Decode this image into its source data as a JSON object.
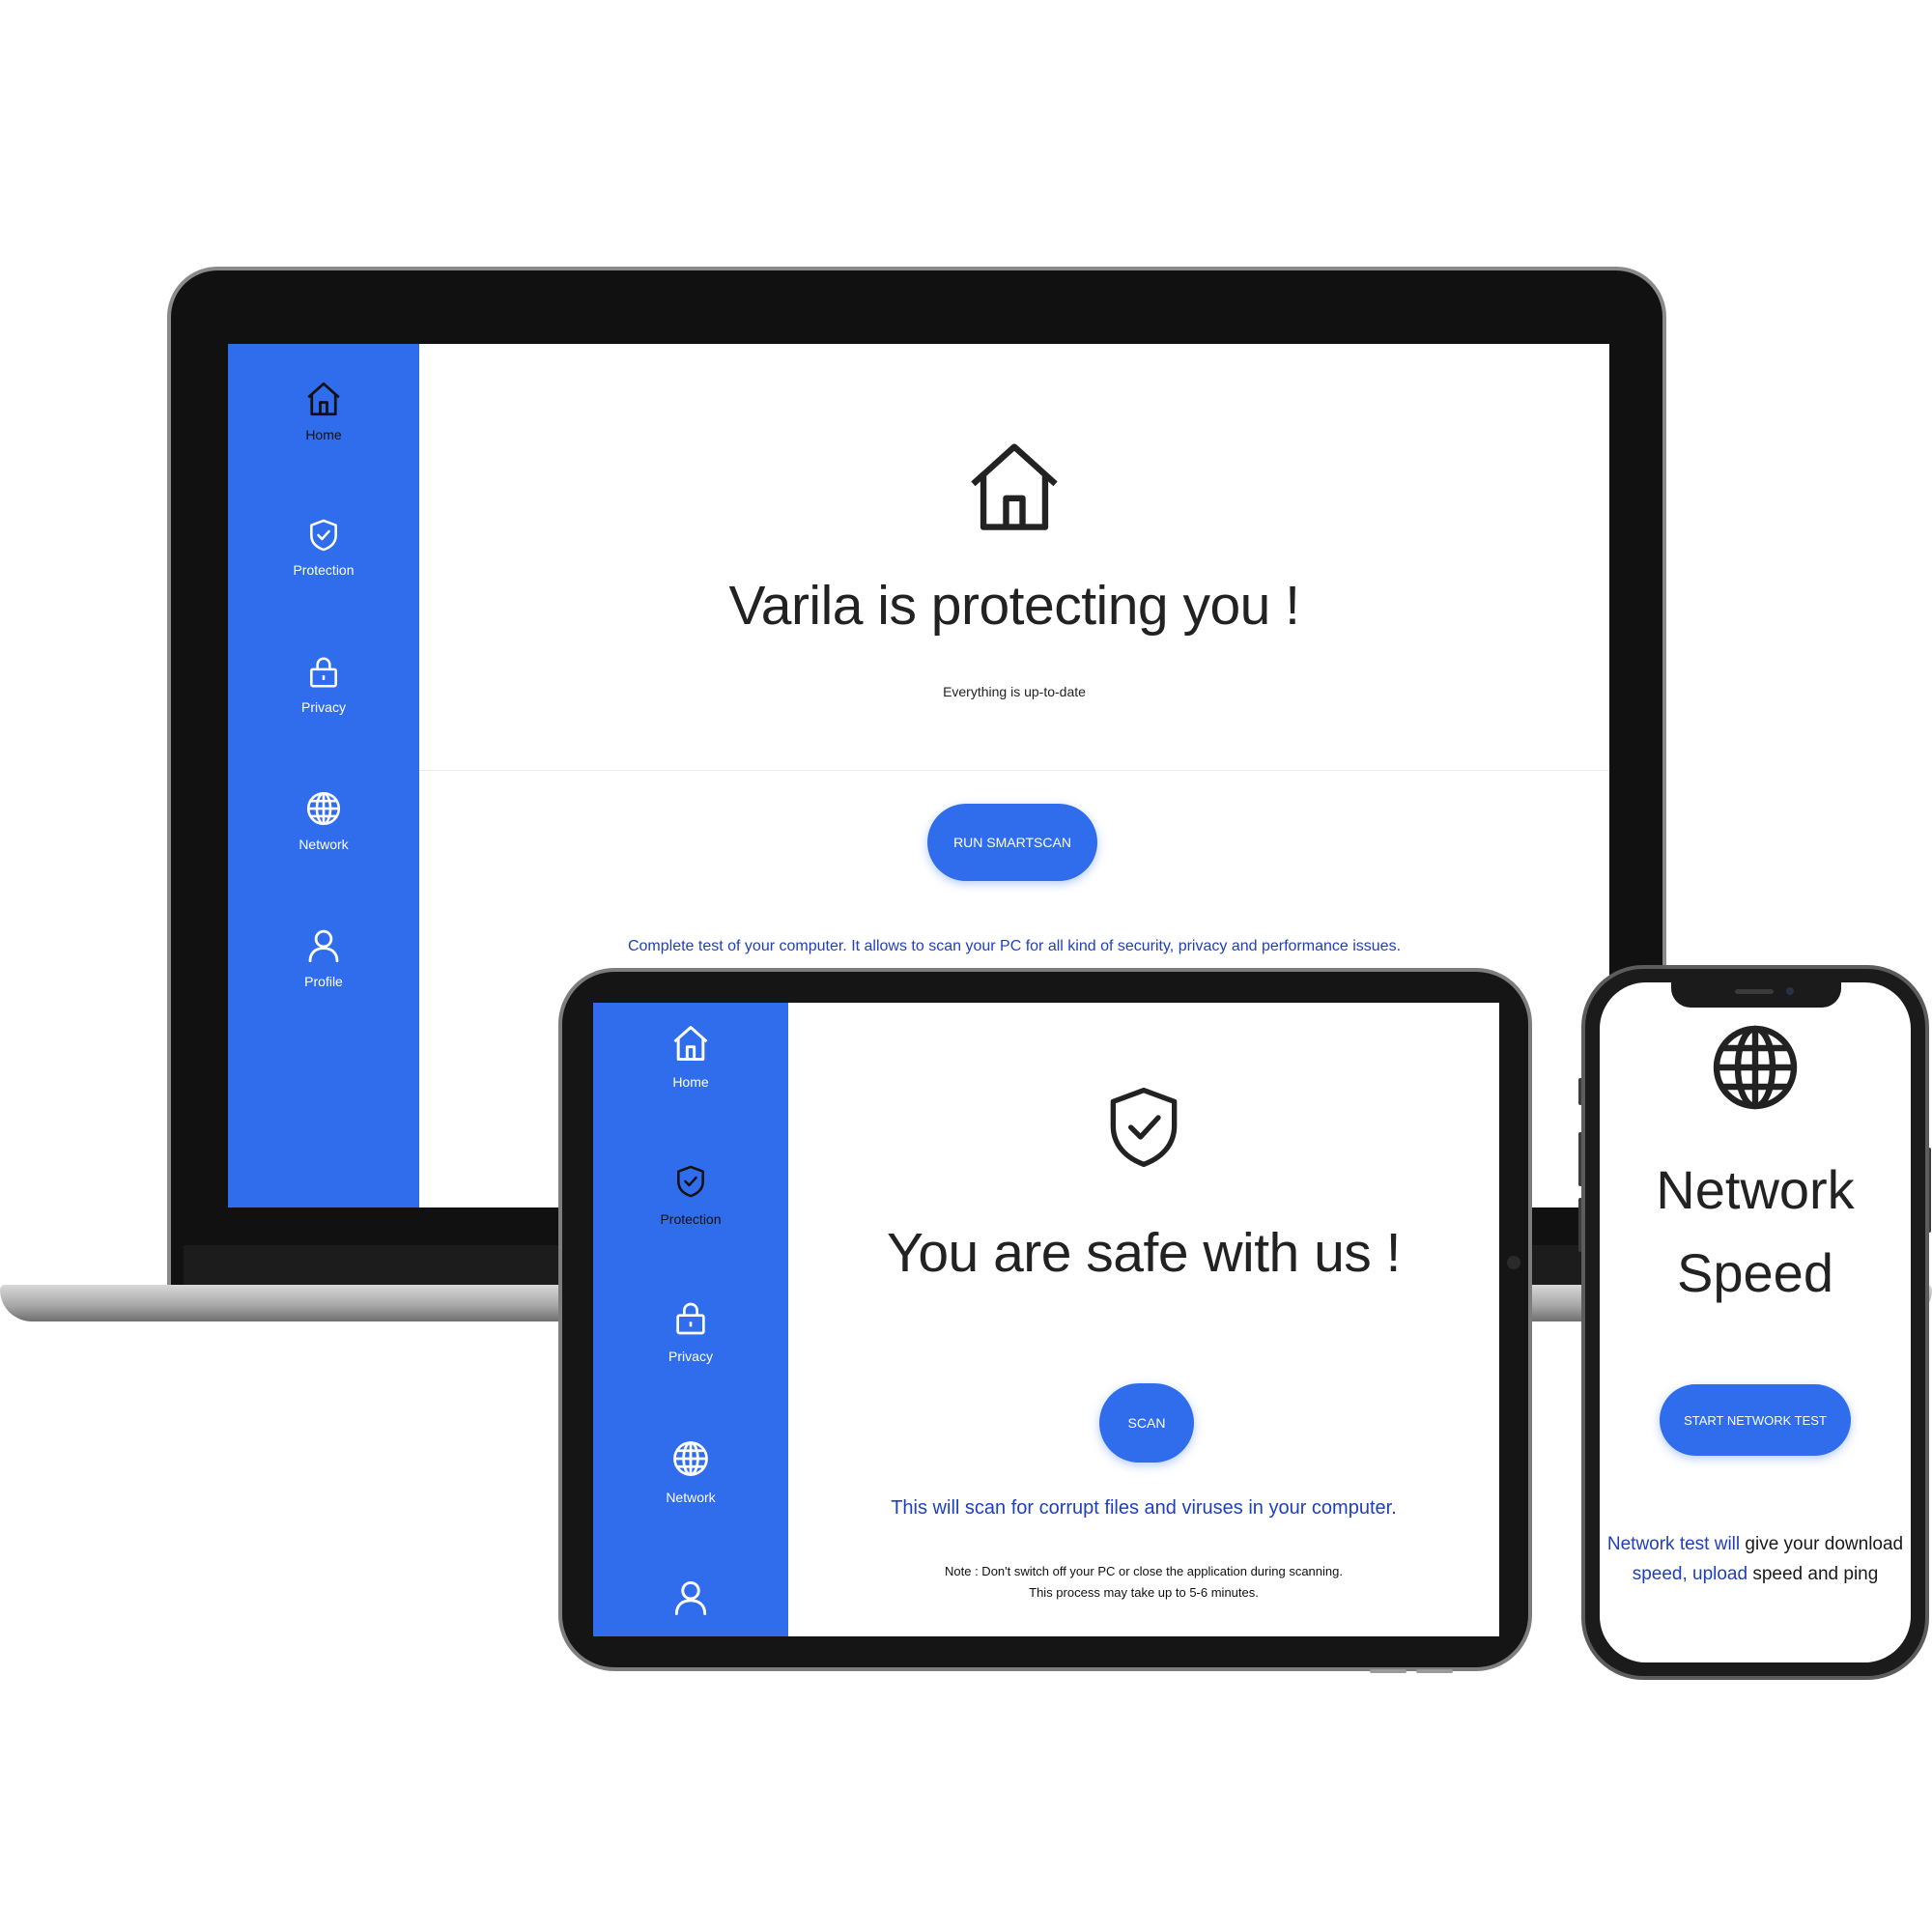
{
  "sidebar_items": [
    {
      "key": "home",
      "label": "Home",
      "icon": "home-icon"
    },
    {
      "key": "protection",
      "label": "Protection",
      "icon": "shield-check-icon"
    },
    {
      "key": "privacy",
      "label": "Privacy",
      "icon": "lock-icon"
    },
    {
      "key": "network",
      "label": "Network",
      "icon": "globe-icon"
    },
    {
      "key": "profile",
      "label": "Profile",
      "icon": "user-icon"
    }
  ],
  "laptop": {
    "headline": "Varila is protecting you !",
    "subtitle": "Everything is up-to-date",
    "button_label": "RUN SMARTSCAN",
    "description": "Complete test of your computer. It allows to scan your PC for all kind of security, privacy and performance issues."
  },
  "tablet": {
    "headline": "You are safe with us !",
    "button_label": "SCAN",
    "description": "This will scan for corrupt files and viruses in your computer.",
    "note_line1": "Note : Don't switch off your PC or close the application during scanning.",
    "note_line2": "This process may take up to 5-6 minutes."
  },
  "phone": {
    "headline_line1": "Network",
    "headline_line2": "Speed",
    "button_label": "START NETWORK TEST",
    "description_part1": "Network test will",
    "description_part2": " give your download",
    "description_part3": "speed, upload",
    "description_part4": " speed and ping"
  },
  "colors": {
    "accent": "#2f6ded",
    "link_text": "#1f3fbf",
    "heading": "#222222",
    "background": "#ffffff"
  }
}
